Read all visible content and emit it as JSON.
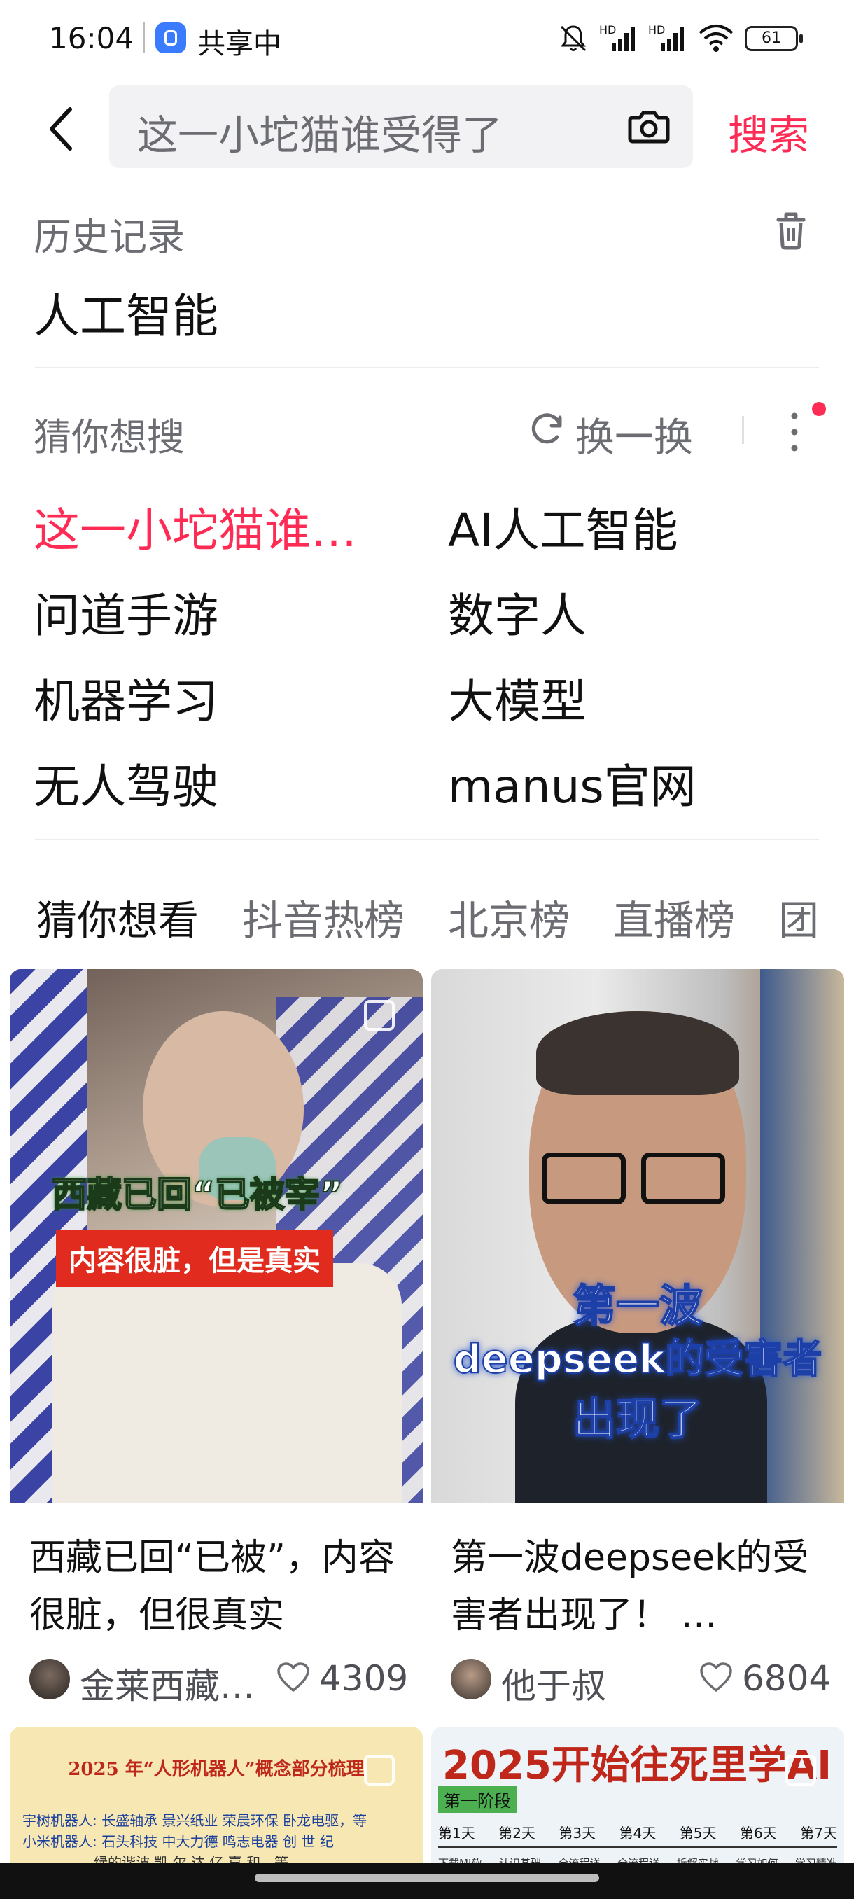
{
  "status_bar": {
    "time": "16:04",
    "share_label": "共享中",
    "battery": "61",
    "hd1": "HD",
    "hd2": "HD"
  },
  "search": {
    "value": "这一小坨猫谁受得了",
    "button": "搜索"
  },
  "history": {
    "title": "历史记录",
    "items": [
      "人工智能"
    ]
  },
  "guess": {
    "title": "猜你想搜",
    "refresh_label": "换一换",
    "suggestions": [
      "这一小坨猫谁…",
      "AI人工智能",
      "问道手游",
      "数字人",
      "机器学习",
      "大模型",
      "无人驾驶",
      "manus官网"
    ]
  },
  "tabs": [
    "猜你想看",
    "抖音热榜",
    "北京榜",
    "直播榜",
    "团"
  ],
  "feed": [
    {
      "thumb_title": "西藏已回“已被宰”",
      "thumb_banner": "内容很脏，但是真实",
      "caption": "西藏已回“已被”，内容很脏，但很真实",
      "author": "金莱西藏…",
      "likes": "4309"
    },
    {
      "thumb_text_1": "第一波",
      "thumb_text_2": "deepseek的受害者",
      "thumb_text_3": "出现了",
      "caption": "第一波deepseek的受害者出现了！ …",
      "author": "他于叔",
      "likes": "6804"
    },
    {
      "thumb_title": "2025 年“人形机器人”概念部分梳理",
      "line1": "宇树机器人: 长盛轴承  景兴纸业  荣晨环保  卧龙电驱，等",
      "line2": "小米机器人: 石头科技  中大力德  鸣志电器  创 世 纪",
      "line3": "绿的谐波  凯 尔 达  亿 嘉 和，等"
    },
    {
      "thumb_title": "2025开始往死里学AI",
      "stage": "第一阶段",
      "days": [
        "第1天",
        "第2天",
        "第3天",
        "第4天",
        "第5天",
        "第6天",
        "第7天"
      ],
      "subs": [
        "下载MI软",
        "认识基础",
        "全流程详",
        "全流程详",
        "拆解实战",
        "学习如何",
        "学习精准"
      ]
    }
  ],
  "colors": {
    "accent": "#fe2c55",
    "muted": "#6c6d72",
    "text": "#161823"
  }
}
